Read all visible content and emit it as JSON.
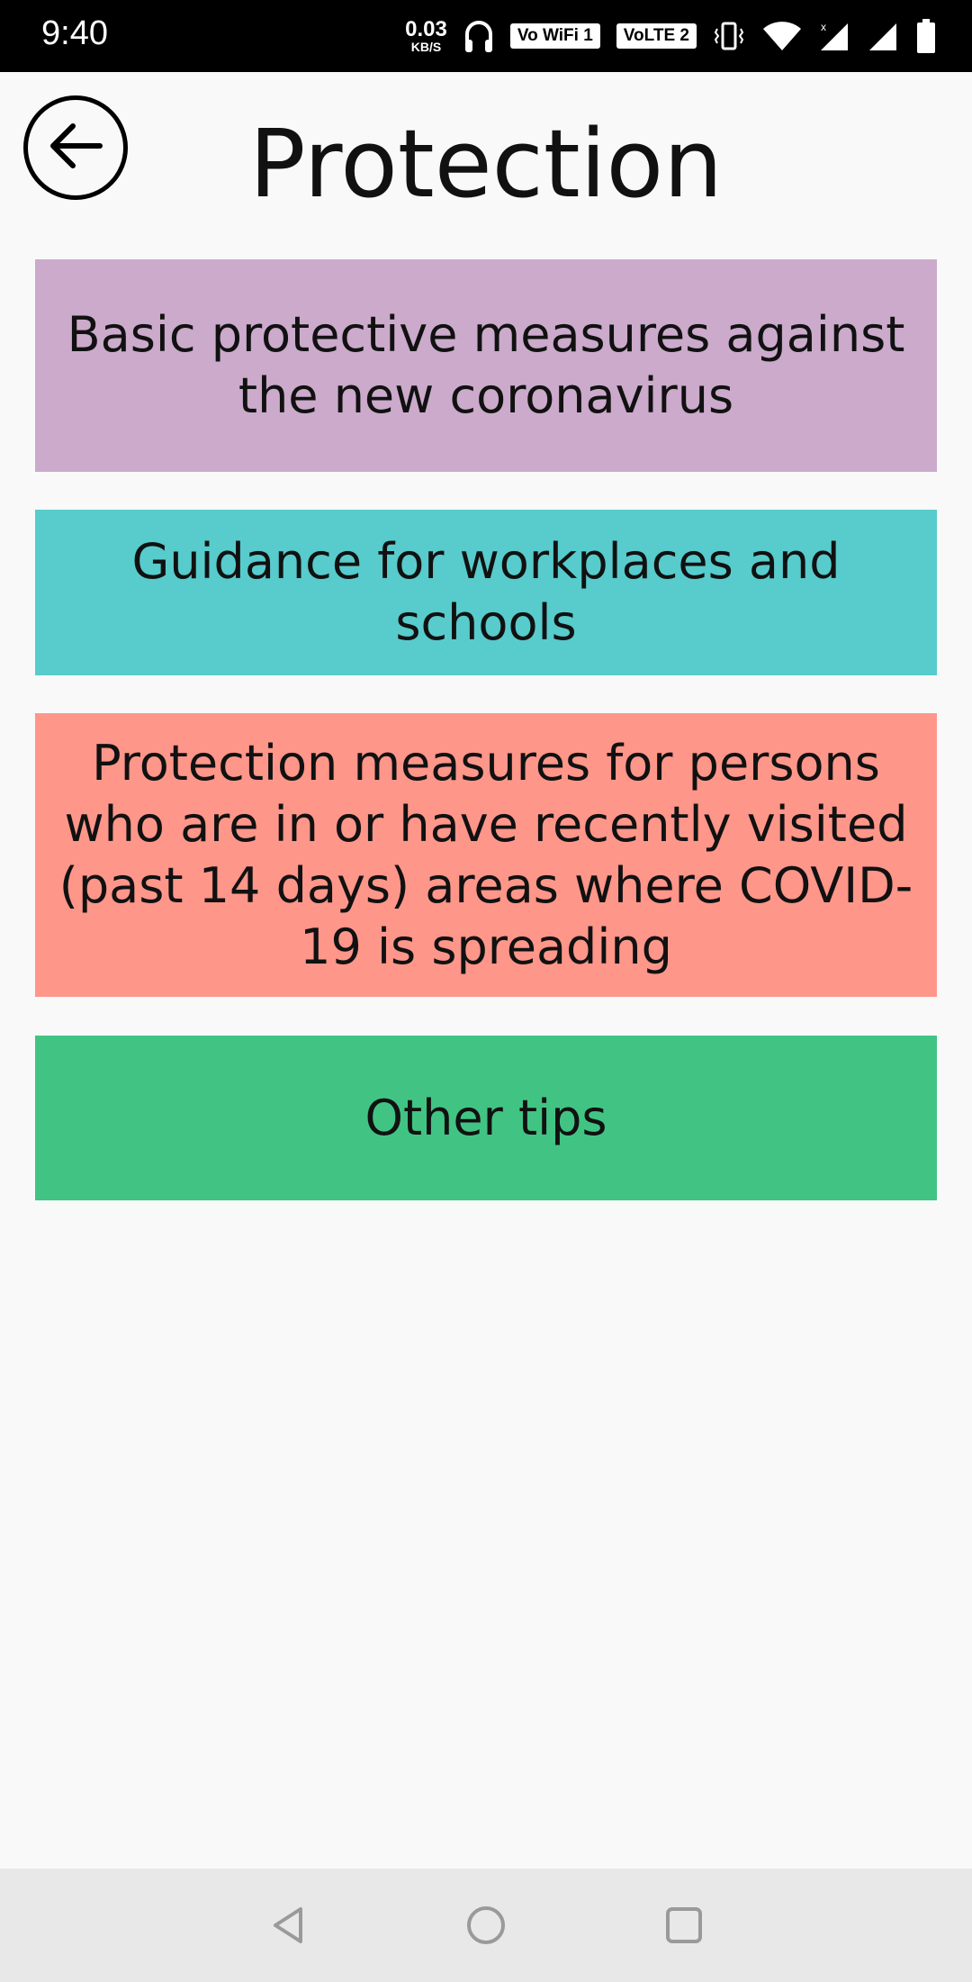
{
  "status_bar": {
    "time": "9:40",
    "speed_value": "0.03",
    "speed_unit": "KB/S",
    "wifi_badge": "Vo WiFi 1",
    "lte_badge": "VoLTE 2"
  },
  "header": {
    "title": "Protection"
  },
  "topics": [
    {
      "label": "Basic protective measures against the new coronavirus",
      "color": "#cbaacb"
    },
    {
      "label": "Guidance for workplaces and schools",
      "color": "#58cbcc"
    },
    {
      "label": "Protection measures for persons who are in or have recently visited (past 14 days) areas where COVID-19 is spreading",
      "color": "#ff968a"
    },
    {
      "label": "Other tips",
      "color": "#41c483"
    }
  ],
  "icons": {
    "back": "back-arrow-icon",
    "nav_back": "triangle-back-icon",
    "nav_home": "circle-home-icon",
    "nav_recents": "square-recents-icon"
  }
}
